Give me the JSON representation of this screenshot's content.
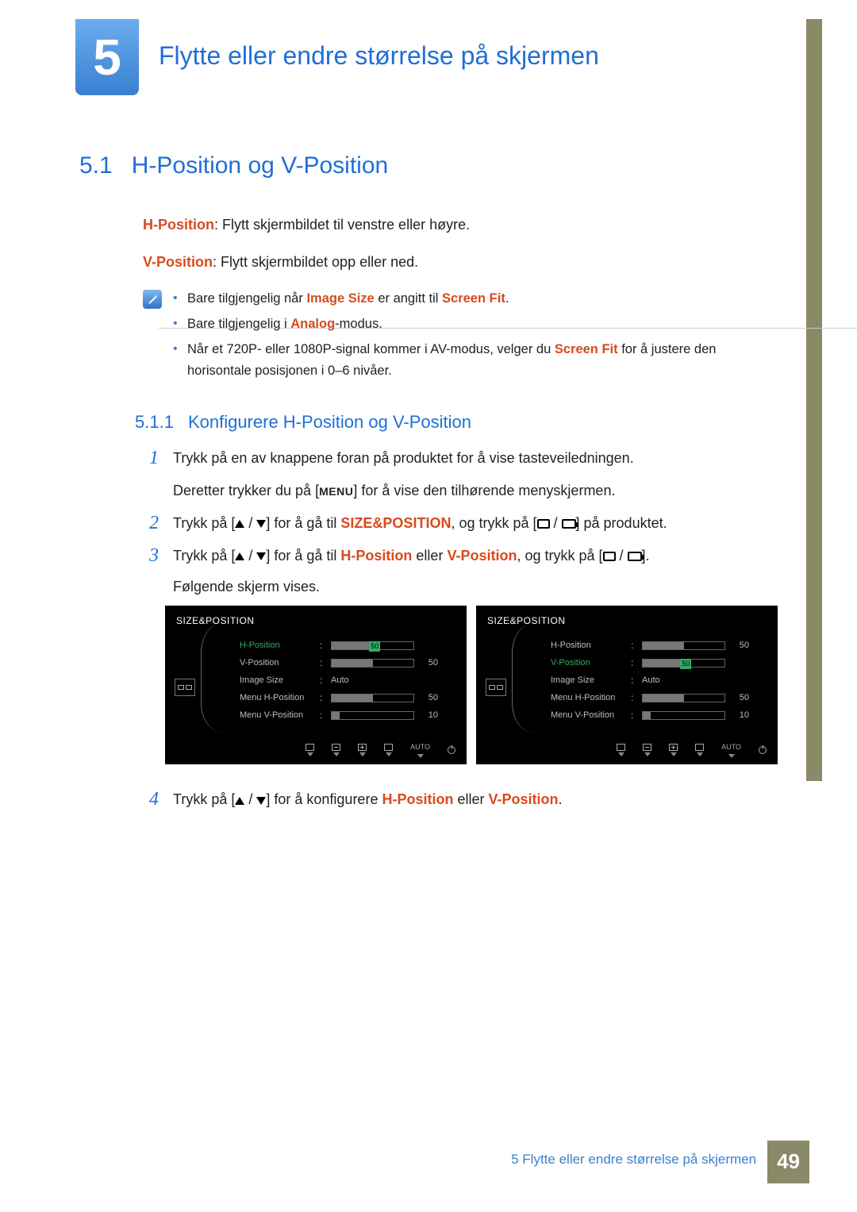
{
  "chapter": {
    "number": "5",
    "title": "Flytte eller endre størrelse på skjermen"
  },
  "section": {
    "number": "5.1",
    "title": "H-Position og V-Position"
  },
  "intro": {
    "hpos_label": "H-Position",
    "hpos_text": ": Flytt skjermbildet til venstre eller høyre.",
    "vpos_label": "V-Position",
    "vpos_text": ": Flytt skjermbildet opp eller ned."
  },
  "notes": {
    "n1_pre": "Bare tilgjengelig når ",
    "n1_h1": "Image Size",
    "n1_mid": " er angitt til ",
    "n1_h2": "Screen Fit",
    "n1_post": ".",
    "n2_pre": "Bare tilgjengelig i ",
    "n2_h1": "Analog",
    "n2_post": "-modus.",
    "n3_pre": "Når et 720P- eller 1080P-signal kommer i AV-modus, velger du ",
    "n3_h1": "Screen Fit",
    "n3_post": " for å justere den horisontale posisjonen i 0–6 nivåer."
  },
  "subsection": {
    "number": "5.1.1",
    "title": "Konfigurere H-Position og V-Position"
  },
  "steps": {
    "s1a": "Trykk på en av knappene foran på produktet for å vise tasteveiledningen.",
    "s1b_pre": "Deretter trykker du på [",
    "s1b_menu": "MENU",
    "s1b_post": "] for å vise den tilhørende menyskjermen.",
    "s2_pre": "Trykk på [",
    "s2_mid": "] for å gå til ",
    "s2_h1": "SIZE&POSITION",
    "s2_mid2": ", og trykk på [",
    "s2_post": "] på produktet.",
    "s3_pre": "Trykk på [",
    "s3_mid": "] for å gå til ",
    "s3_h1": "H-Position",
    "s3_or": " eller ",
    "s3_h2": "V-Position",
    "s3_mid2": ", og trykk på [",
    "s3_post": "].",
    "s3_follow": "Følgende skjerm vises.",
    "s4_pre": "Trykk på [",
    "s4_mid": "] for å konfigurere ",
    "s4_h1": "H-Position",
    "s4_or": " eller ",
    "s4_h2": "V-Position",
    "s4_post": "."
  },
  "osd": {
    "title": "SIZE&POSITION",
    "labels": {
      "hpos": "H-Position",
      "vpos": "V-Position",
      "imgsize": "Image Size",
      "menuh": "Menu H-Position",
      "menuv": "Menu V-Position"
    },
    "auto": "Auto",
    "left": {
      "highlight": "hpos",
      "values": {
        "hpos": "50",
        "vpos": "50",
        "imgsize": "Auto",
        "menuh": "50",
        "menuv": "10"
      }
    },
    "right": {
      "highlight": "vpos",
      "values": {
        "hpos": "50",
        "vpos": "50",
        "imgsize": "Auto",
        "menuh": "50",
        "menuv": "10"
      }
    },
    "bottom_auto": "AUTO"
  },
  "footer": {
    "text": "5 Flytte eller endre størrelse på skjermen",
    "page": "49"
  }
}
